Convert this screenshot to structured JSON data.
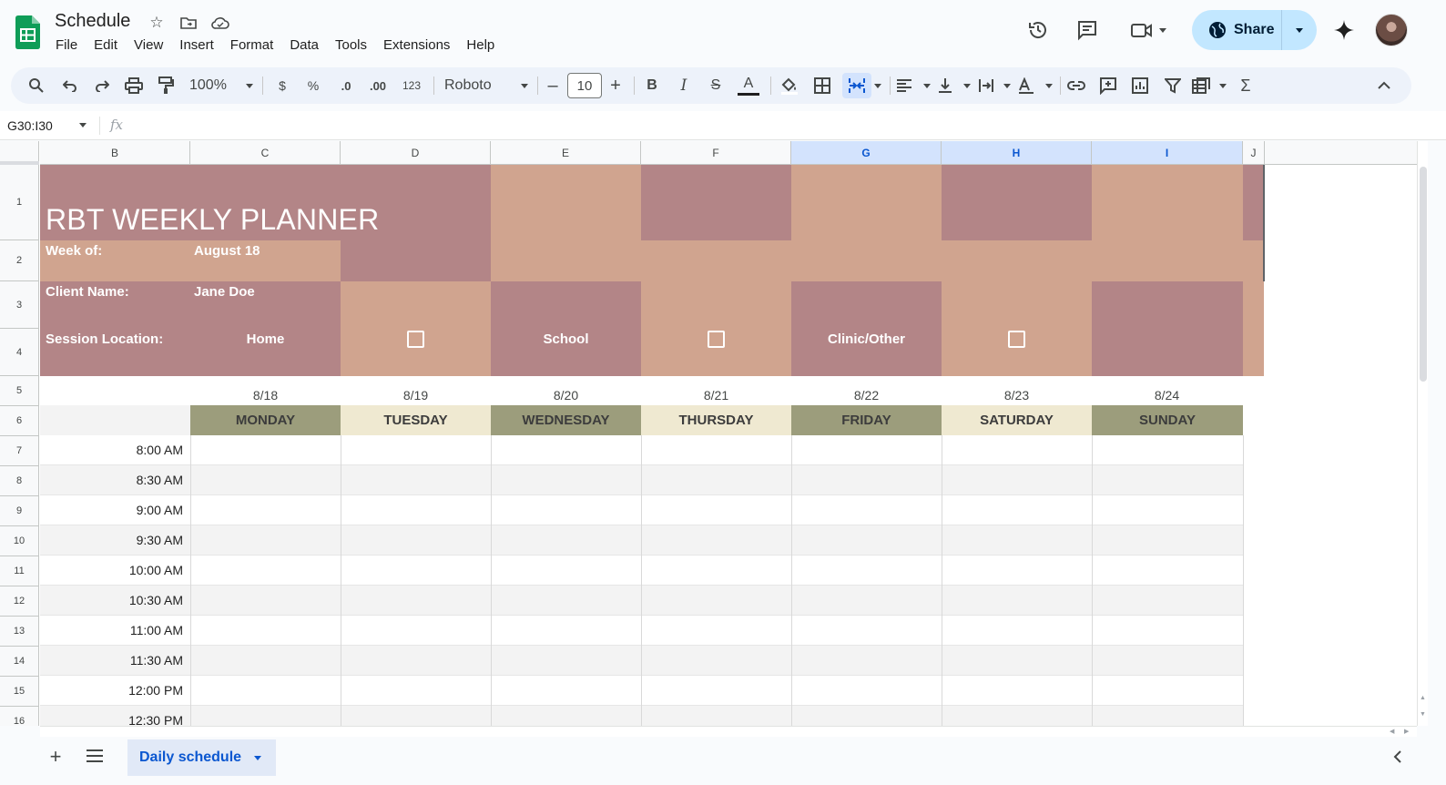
{
  "app": {
    "doc_title": "Schedule",
    "menu": [
      "File",
      "Edit",
      "View",
      "Insert",
      "Format",
      "Data",
      "Tools",
      "Extensions",
      "Help"
    ],
    "share_label": "Share"
  },
  "toolbar": {
    "zoom": "100%",
    "currency": "$",
    "percent": "%",
    "dec_decrease": ".0",
    "dec_increase": ".00",
    "number_format": "123",
    "font": "Roboto",
    "font_size": "10",
    "bold": "B",
    "italic": "I",
    "strike": "S",
    "text_color": "A",
    "sum": "Σ"
  },
  "formula_bar": {
    "name_box": "G30:I30",
    "fx": "fx"
  },
  "columns": [
    "B",
    "C",
    "D",
    "E",
    "F",
    "G",
    "H",
    "I",
    "J"
  ],
  "selected_columns": [
    "G",
    "H",
    "I"
  ],
  "rows": [
    "1",
    "2",
    "3",
    "4",
    "5",
    "6",
    "7",
    "8",
    "9",
    "10",
    "11",
    "12",
    "13",
    "14",
    "15",
    "16"
  ],
  "planner": {
    "title": "RBT WEEKLY PLANNER",
    "week_label": "Week of:",
    "week_value": "August 18",
    "client_label": "Client Name:",
    "client_value": "Jane Doe",
    "location_label": "Session Location:",
    "locations": [
      "Home",
      "School",
      "Clinic/Other"
    ],
    "dates": [
      "8/18",
      "8/19",
      "8/20",
      "8/21",
      "8/22",
      "8/23",
      "8/24"
    ],
    "days": [
      "MONDAY",
      "TUESDAY",
      "WEDNESDAY",
      "THURSDAY",
      "FRIDAY",
      "SATURDAY",
      "SUNDAY"
    ],
    "times": [
      "8:00 AM",
      "8:30 AM",
      "9:00 AM",
      "9:30 AM",
      "10:00 AM",
      "10:30 AM",
      "11:00 AM",
      "11:30 AM",
      "12:00 PM",
      "12:30 PM"
    ]
  },
  "colors": {
    "mauve": "#b38587",
    "tan": "#d0a48f",
    "olive": "#9c9d7c",
    "cream": "#efe9d1",
    "accent": "#0b57d0",
    "share_bg": "#c2e7ff"
  },
  "sheet_tabs": {
    "active": "Daily schedule"
  }
}
